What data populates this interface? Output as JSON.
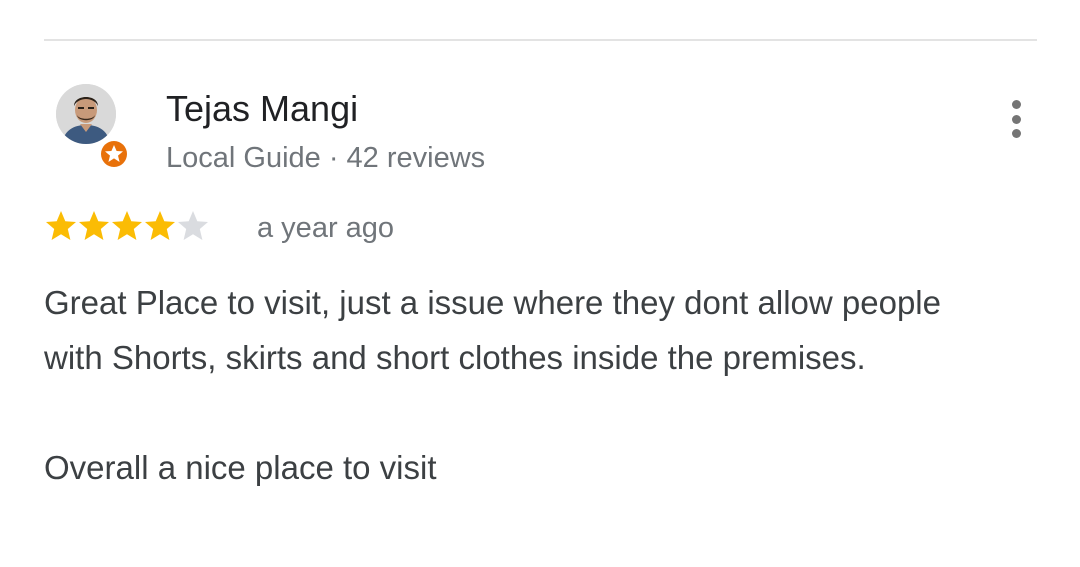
{
  "reviewer": {
    "name": "Tejas Mangi",
    "meta": "Local Guide · 42 reviews",
    "avatar_icon": "user-photo-avatar",
    "badge_icon": "local-guide-star-badge",
    "badge_color": "#e8710a"
  },
  "review": {
    "rating": 4,
    "max_rating": 5,
    "time": "a year ago",
    "star_color": "#fbbc04",
    "empty_star_color": "#dadce0",
    "paragraph_1": "Great Place to visit, just a issue where they dont allow people with Shorts, skirts and short clothes inside the premises.",
    "paragraph_2": "Overall a nice place to visit"
  },
  "actions": {
    "more_icon": "more-vertical-icon"
  }
}
